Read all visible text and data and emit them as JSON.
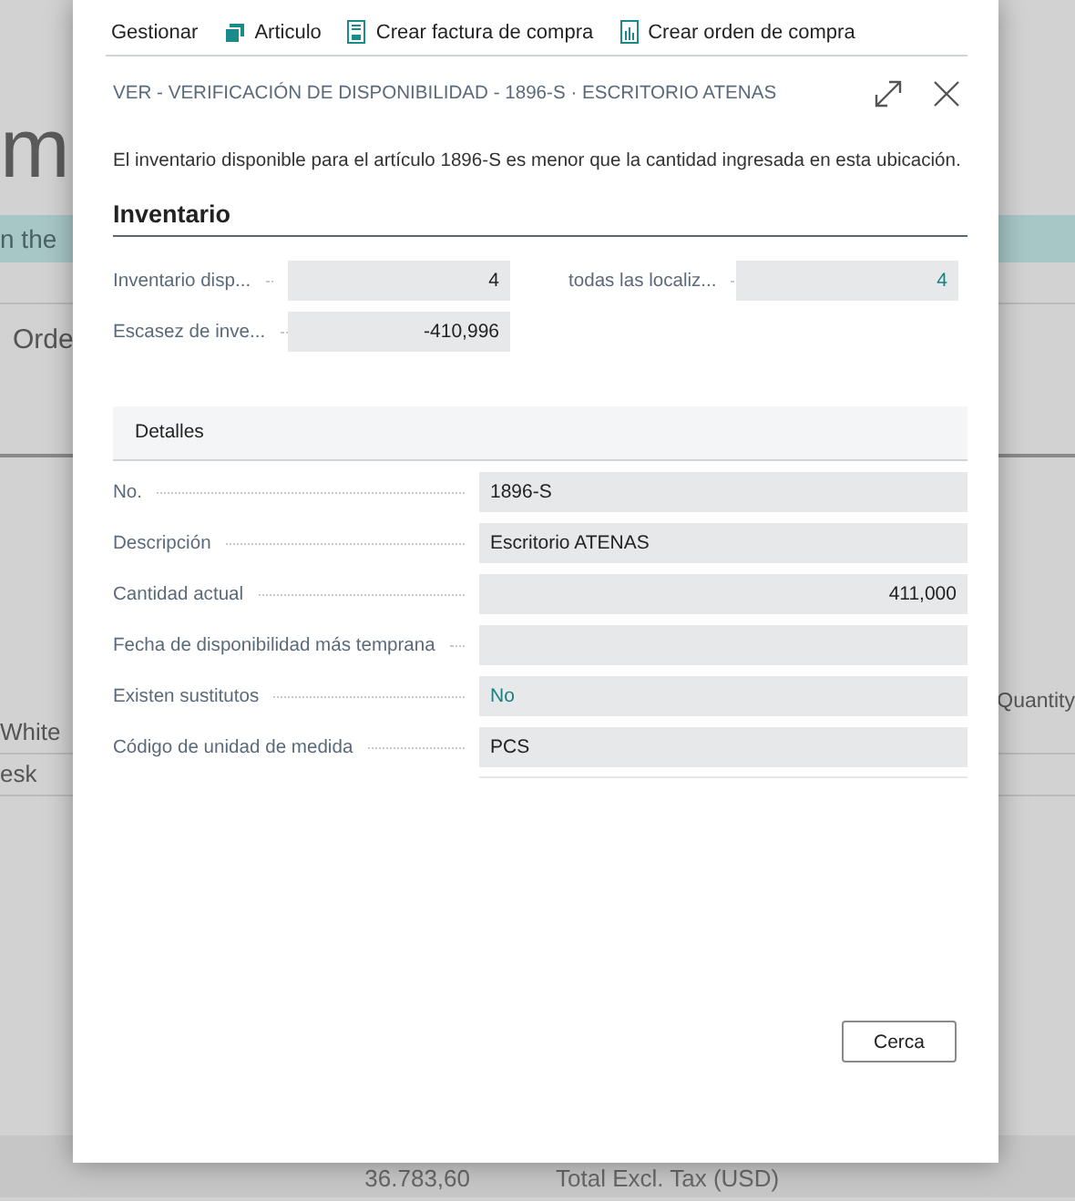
{
  "background": {
    "page_title": "m",
    "banner": "n the",
    "tab": "Orde",
    "rows": [
      "White",
      "esk"
    ],
    "column_header": "Quantity",
    "total_value": "36.783,60",
    "total_label": "Total Excl. Tax (USD)"
  },
  "dialog": {
    "actions": [
      {
        "label": "Gestionar"
      },
      {
        "label": "Articulo"
      },
      {
        "label": "Crear factura de compra"
      },
      {
        "label": "Crear orden de compra"
      }
    ],
    "title": "VER - VERIFICACIÓN DE DISPONIBILIDAD - 1896-S · ESCRITORIO ATENAS",
    "message": "El inventario disponible para el artículo 1896-S es menor que la cantidad ingresada en esta ubicación.",
    "inventory": {
      "heading": "Inventario",
      "fields": [
        {
          "label": "Inventario disp...",
          "value": "4",
          "link": false
        },
        {
          "label": "todas las localiz...",
          "value": "4",
          "link": true
        },
        {
          "label": "Escasez de inve...",
          "value": "-410,996",
          "link": false
        }
      ]
    },
    "details": {
      "heading": "Detalles",
      "fields": [
        {
          "kind": "text",
          "label": "No.",
          "value": "1896-S",
          "link": false
        },
        {
          "kind": "text",
          "label": "Descripción",
          "value": "Escritorio ATENAS",
          "link": false
        },
        {
          "kind": "number",
          "label": "Cantidad actual",
          "value": "411,000",
          "link": false
        },
        {
          "kind": "text",
          "label": "Fecha de disponibilidad más temprana"
        },
        {
          "kind": "text",
          "label": "Existen sustitutos",
          "value": "No",
          "link": true
        },
        {
          "kind": "text",
          "label": "Código de unidad de medida",
          "value": "PCS",
          "link": false
        }
      ]
    },
    "close_button": "Cerca"
  }
}
